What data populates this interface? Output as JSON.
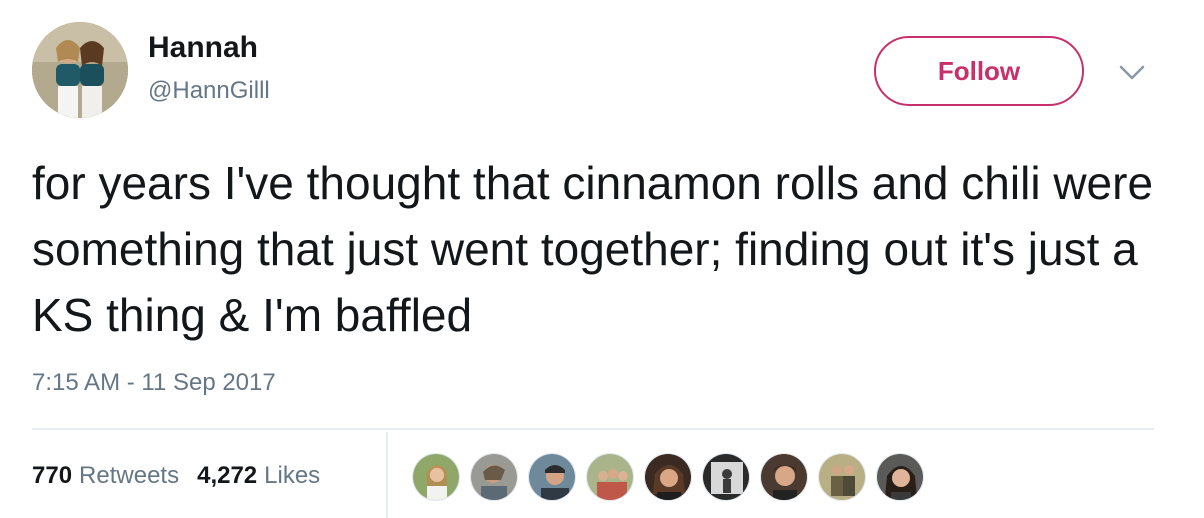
{
  "user": {
    "display_name": "Hannah",
    "handle": "@HannGilll",
    "avatar_icon": "profile-photo"
  },
  "follow_button_label": "Follow",
  "menu_icon": "chevron-down-icon",
  "tweet": {
    "text": "for years I've thought that cinnamon rolls and chili were something that just went together; finding out it's just a KS thing & I'm baffled",
    "timestamp": "7:15 AM - 11 Sep 2017"
  },
  "stats": {
    "retweets_count": "770",
    "retweets_label": "Retweets",
    "likes_count": "4,272",
    "likes_label": "Likes"
  },
  "colors": {
    "accent": "#c7306a",
    "text_primary": "#14171a",
    "text_secondary": "#657786",
    "divider": "#e6ecf0"
  }
}
